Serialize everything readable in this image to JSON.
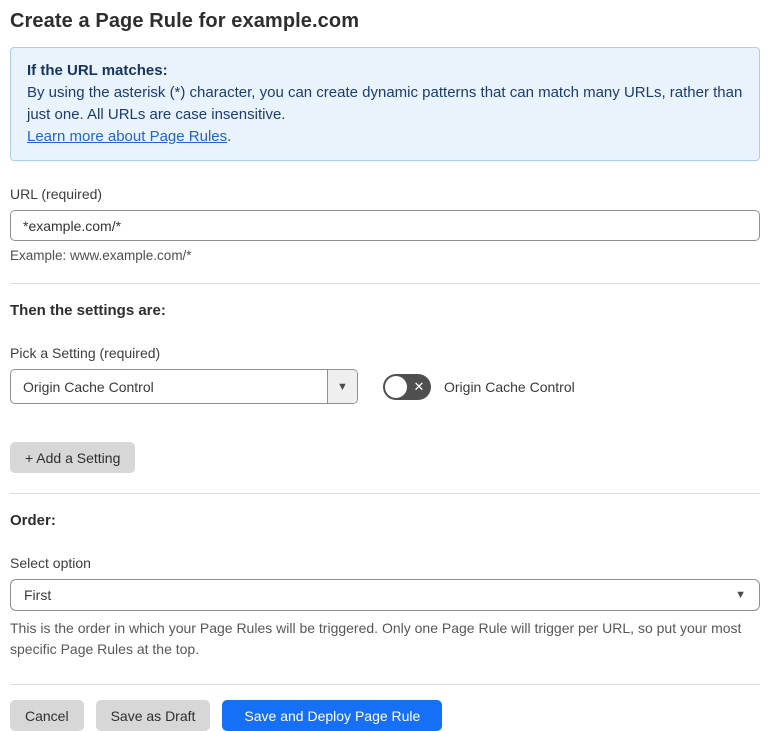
{
  "page": {
    "title": "Create a Page Rule for example.com"
  },
  "info_box": {
    "heading": "If the URL matches:",
    "body": "By using the asterisk (*) character, you can create dynamic patterns that can match many URLs, rather than just one. All URLs are case insensitive.",
    "link_label": "Learn more about Page Rules",
    "link_suffix": "."
  },
  "url_field": {
    "label": "URL (required)",
    "value": "*example.com/*",
    "hint": "Example: www.example.com/*"
  },
  "settings_section": {
    "heading": "Then the settings are:",
    "picker_label": "Pick a Setting (required)",
    "picker_value": "Origin Cache Control",
    "picker_arrow": "▼",
    "toggle_state": "off",
    "toggle_icon": "✕",
    "toggle_label": "Origin Cache Control",
    "add_button_label": "+ Add a Setting"
  },
  "order_section": {
    "heading": "Order:",
    "select_label": "Select option",
    "select_value": "First",
    "select_arrow": "▼",
    "help_text": "This is the order in which your Page Rules will be triggered. Only one Page Rule will trigger per URL, so put your most specific Page Rules at the top."
  },
  "footer": {
    "cancel_label": "Cancel",
    "save_draft_label": "Save as Draft",
    "save_deploy_label": "Save and Deploy Page Rule"
  },
  "colors": {
    "accent_blue": "#1670f5",
    "info_background": "#e9f3fc",
    "info_border": "#abceef",
    "info_text": "#1d3c6e",
    "link_blue": "#2063d1",
    "toggle_off_background": "#4f4f4f",
    "button_gray": "#d7d7d7"
  }
}
